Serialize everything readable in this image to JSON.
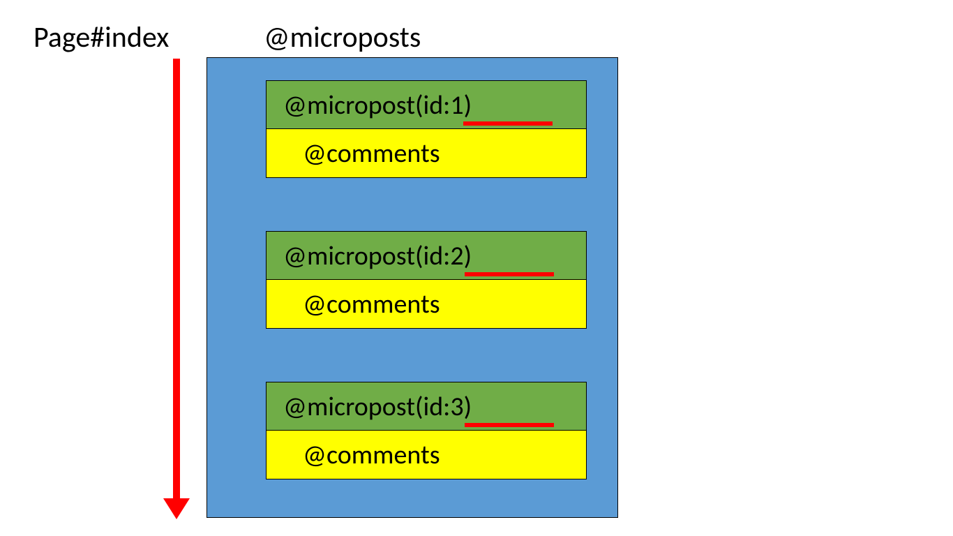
{
  "page_label": "Page#index",
  "microposts_label": "@microposts",
  "colors": {
    "container": "#5b9bd5",
    "micropost_bg": "#70ad47",
    "comments_bg": "#ffff00",
    "arrow": "#ff0000",
    "underline": "#ff0000"
  },
  "posts": [
    {
      "micropost": "@micropost(id:1)",
      "comments": "@comments"
    },
    {
      "micropost": "@micropost(id:2)",
      "comments": "@comments"
    },
    {
      "micropost": "@micropost(id:3)",
      "comments": "@comments"
    }
  ]
}
